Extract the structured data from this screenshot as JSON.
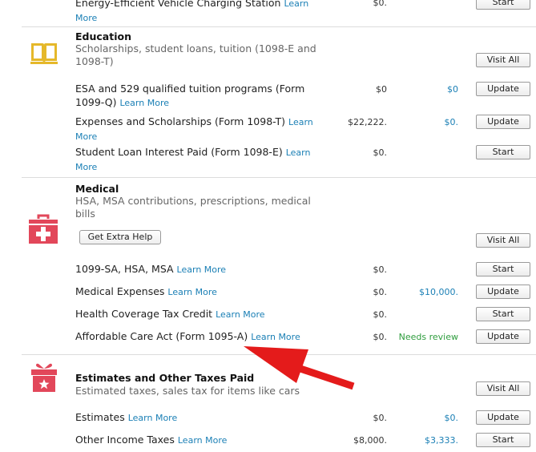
{
  "colors": {
    "link": "#1a7fb5",
    "review": "#2f9d3e",
    "education_icon": "#e5b82a",
    "medical_icon": "#e2475a",
    "arrow": "#e41b1b"
  },
  "top": {
    "label": "Energy-Efficient Vehicle Charging Station",
    "learn": "Learn More",
    "amount": "$0.",
    "button": "Start"
  },
  "education": {
    "icon": "book-icon",
    "title": "Education",
    "desc": "Scholarships, student loans, tuition (1098-E and 1098-T)",
    "visit_all": "Visit All",
    "rows": [
      {
        "label": "ESA and 529 qualified tuition programs (Form 1099-Q)",
        "learn": "Learn More",
        "amount": "$0",
        "amount2": "$0",
        "button": "Update"
      },
      {
        "label": "Expenses and Scholarships (Form 1098-T)",
        "learn": "Learn More",
        "amount": "$22,222.",
        "amount2": "$0.",
        "button": "Update"
      },
      {
        "label": "Student Loan Interest Paid (Form 1098-E)",
        "learn": "Learn More",
        "amount": "$0.",
        "amount2": "",
        "button": "Start"
      }
    ]
  },
  "medical": {
    "icon": "medical-kit-icon",
    "title": "Medical",
    "desc": "HSA, MSA contributions, prescriptions, medical bills",
    "help_button": "Get Extra Help",
    "visit_all": "Visit All",
    "rows": [
      {
        "label": "1099-SA, HSA, MSA",
        "learn": "Learn More",
        "amount": "$0.",
        "amount2": "",
        "button": "Start"
      },
      {
        "label": "Medical Expenses",
        "learn": "Learn More",
        "amount": "$0.",
        "amount2": "$10,000.",
        "button": "Update"
      },
      {
        "label": "Health Coverage Tax Credit",
        "learn": "Learn More",
        "amount": "$0.",
        "amount2": "",
        "button": "Start"
      },
      {
        "label": "Affordable Care Act (Form 1095-A)",
        "learn": "Learn More",
        "amount": "$0.",
        "status": "Needs review",
        "button": "Update"
      }
    ]
  },
  "estimates": {
    "icon": "gift-box-icon",
    "title": "Estimates and Other Taxes Paid",
    "desc": "Estimated taxes, sales tax for items like cars",
    "visit_all": "Visit All",
    "rows": [
      {
        "label": "Estimates",
        "learn": "Learn More",
        "amount": "$0.",
        "amount2": "$0.",
        "button": "Update"
      },
      {
        "label": "Other Income Taxes",
        "learn": "Learn More",
        "amount": "$8,000.",
        "amount2": "$3,333.",
        "button": "Start"
      }
    ]
  }
}
